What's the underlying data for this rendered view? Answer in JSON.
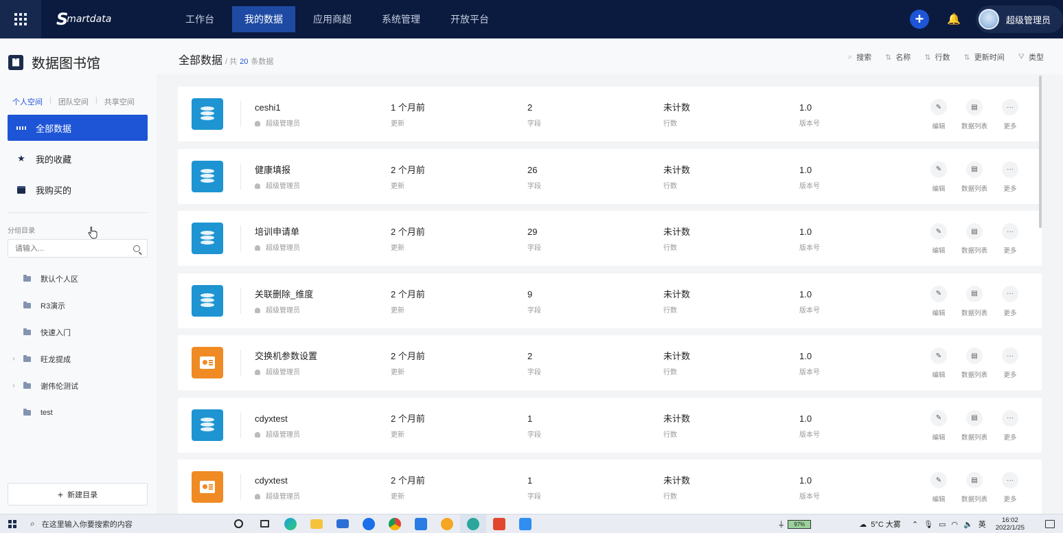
{
  "topbar": {
    "logo": "martdata",
    "nav": [
      "工作台",
      "我的数据",
      "应用商超",
      "系统管理",
      "开放平台"
    ],
    "active_nav": "我的数据",
    "user_name": "超级管理员"
  },
  "sidebar": {
    "title": "数据图书馆",
    "space_tabs": [
      "个人空间",
      "团队空间",
      "共享空间"
    ],
    "menu": [
      "全部数据",
      "我的收藏",
      "我购买的"
    ],
    "group_label": "分组目录",
    "search_placeholder": "请输入...",
    "folders": [
      {
        "name": "默认个人区",
        "expandable": false
      },
      {
        "name": "R3演示",
        "expandable": false
      },
      {
        "name": "快速入门",
        "expandable": false
      },
      {
        "name": "旺龙提成",
        "expandable": true
      },
      {
        "name": "谢伟伦测试",
        "expandable": true
      },
      {
        "name": "test",
        "expandable": false
      }
    ],
    "new_dir": "新建目录"
  },
  "main": {
    "title": "全部数据",
    "count_prefix": "/ 共",
    "count": "20",
    "count_suffix": "条数据",
    "sorts": [
      "搜索",
      "名称",
      "行数",
      "更新时间",
      "类型"
    ],
    "labels": {
      "updated": "更新",
      "fields": "字段",
      "rows": "行数",
      "version": "版本号"
    },
    "actions": [
      "编辑",
      "数据列表",
      "更多"
    ],
    "items": [
      {
        "name": "ceshi1",
        "owner": "超级管理员",
        "updated": "1 个月前",
        "fields": "2",
        "rows": "未计数",
        "version": "1.0",
        "icon": "mysql"
      },
      {
        "name": "健康填报",
        "owner": "超级管理员",
        "updated": "2 个月前",
        "fields": "26",
        "rows": "未计数",
        "version": "1.0",
        "icon": "mysql"
      },
      {
        "name": "培训申请单",
        "owner": "超级管理员",
        "updated": "2 个月前",
        "fields": "29",
        "rows": "未计数",
        "version": "1.0",
        "icon": "mysql"
      },
      {
        "name": "关联删除_维度",
        "owner": "超级管理员",
        "updated": "2 个月前",
        "fields": "9",
        "rows": "未计数",
        "version": "1.0",
        "icon": "mysql"
      },
      {
        "name": "交换机参数设置",
        "owner": "超级管理员",
        "updated": "2 个月前",
        "fields": "2",
        "rows": "未计数",
        "version": "1.0",
        "icon": "ppt"
      },
      {
        "name": "cdyxtest",
        "owner": "超级管理员",
        "updated": "2 个月前",
        "fields": "1",
        "rows": "未计数",
        "version": "1.0",
        "icon": "mysql"
      },
      {
        "name": "cdyxtest",
        "owner": "超级管理员",
        "updated": "2 个月前",
        "fields": "1",
        "rows": "未计数",
        "version": "1.0",
        "icon": "ppt"
      }
    ]
  },
  "taskbar": {
    "search_placeholder": "在这里输入你要搜索的内容",
    "battery": "97%",
    "weather": "5°C 大雾",
    "ime": "英",
    "time": "16:02",
    "date": "2022/1/25"
  }
}
